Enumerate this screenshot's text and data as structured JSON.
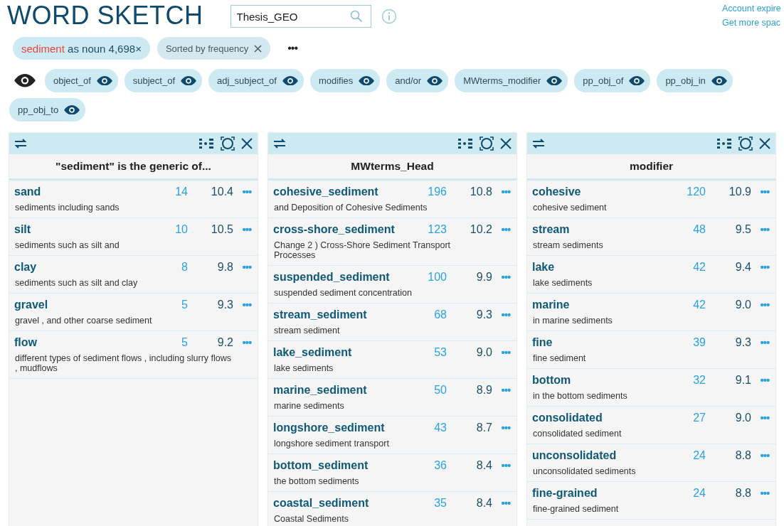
{
  "header": {
    "title": "WORD SKETCH",
    "search": {
      "value": "Thesis_GEO"
    },
    "links": [
      "Account expire",
      "Get more spac"
    ]
  },
  "query_chip": {
    "headword": "sediment",
    "rest": "as noun 4,698×"
  },
  "sort_chip": {
    "label": "Sorted by frequency"
  },
  "more": "•••",
  "relations": [
    "object_of",
    "subject_of",
    "adj_subject_of",
    "modifies",
    "and/or",
    "MWterms_modifier",
    "pp_obj_of",
    "pp_obj_in",
    "pp_obj_to"
  ],
  "columns": [
    {
      "title": "\"sediment\" is the generic of...",
      "rows": [
        {
          "word": "sand",
          "count": "14",
          "score": "10.4",
          "example": "sediments including sands"
        },
        {
          "word": "silt",
          "count": "10",
          "score": "10.5",
          "example": "sediments such as silt and"
        },
        {
          "word": "clay",
          "count": "8",
          "score": "9.8",
          "example": "sediments such as silt and clay"
        },
        {
          "word": "gravel",
          "count": "5",
          "score": "9.3",
          "example": "gravel , and other coarse sediment"
        },
        {
          "word": "flow",
          "count": "5",
          "score": "9.2",
          "example": "different types of sediment flows , including slurry flows , mudflows"
        }
      ]
    },
    {
      "title": "MWterms_Head",
      "rows": [
        {
          "word": "cohesive_sediment",
          "count": "196",
          "score": "10.8",
          "example": "and Deposition of Cohesive Sediments"
        },
        {
          "word": "cross-shore_sediment",
          "count": "123",
          "score": "10.2",
          "example": "Change 2 ) Cross-Shore Sediment Transport Processes"
        },
        {
          "word": "suspended_sediment",
          "count": "100",
          "score": "9.9",
          "example": "suspended sediment concentration"
        },
        {
          "word": "stream_sediment",
          "count": "68",
          "score": "9.3",
          "example": "stream sediment"
        },
        {
          "word": "lake_sediment",
          "count": "53",
          "score": "9.0",
          "example": "lake sediments"
        },
        {
          "word": "marine_sediment",
          "count": "50",
          "score": "8.9",
          "example": "marine sediments"
        },
        {
          "word": "longshore_sediment",
          "count": "43",
          "score": "8.7",
          "example": "longshore sediment transport"
        },
        {
          "word": "bottom_sediment",
          "count": "36",
          "score": "8.4",
          "example": "the bottom sediments"
        },
        {
          "word": "coastal_sediment",
          "count": "35",
          "score": "8.4",
          "example": "Coastal Sediments"
        }
      ]
    },
    {
      "title": "modifier",
      "rows": [
        {
          "word": "cohesive",
          "count": "120",
          "score": "10.9",
          "example": "cohesive sediment"
        },
        {
          "word": "stream",
          "count": "48",
          "score": "9.5",
          "example": "stream sediments"
        },
        {
          "word": "lake",
          "count": "42",
          "score": "9.4",
          "example": "lake sediments"
        },
        {
          "word": "marine",
          "count": "42",
          "score": "9.0",
          "example": "in marine sediments"
        },
        {
          "word": "fine",
          "count": "39",
          "score": "9.3",
          "example": "fine sediment"
        },
        {
          "word": "bottom",
          "count": "32",
          "score": "9.1",
          "example": "in the bottom sediments"
        },
        {
          "word": "consolidated",
          "count": "27",
          "score": "9.0",
          "example": "consolidated sediment"
        },
        {
          "word": "unconsolidated",
          "count": "24",
          "score": "8.8",
          "example": "unconsolidated sediments"
        },
        {
          "word": "fine-grained",
          "count": "24",
          "score": "8.8",
          "example": "fine-grained sediment"
        }
      ]
    }
  ]
}
